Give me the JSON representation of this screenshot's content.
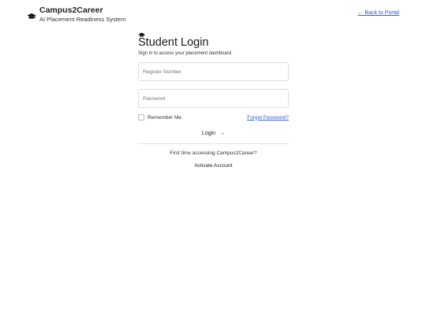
{
  "header": {
    "brand_name": "Campus2Career",
    "tagline": "AI Placement Readiness System",
    "back_link": "← Back to Portal",
    "icon": "graduation-cap-icon"
  },
  "login": {
    "icon": "graduation-cap-icon",
    "title": "Student Login",
    "subtitle": "Sign in to access your placement dashboard.",
    "register_placeholder": "Register Number",
    "register_value": "",
    "password_placeholder": "Password",
    "password_value": "",
    "remember_label": "Remember Me",
    "forgot_link": "Forgot Password?",
    "submit_label": "Login",
    "first_time_text": "First time accessing Campus2Career?",
    "activate_label": "Activate Account"
  },
  "colors": {
    "link": "#2f5bd7",
    "border": "#dcdcdc",
    "text": "#1f2328"
  }
}
